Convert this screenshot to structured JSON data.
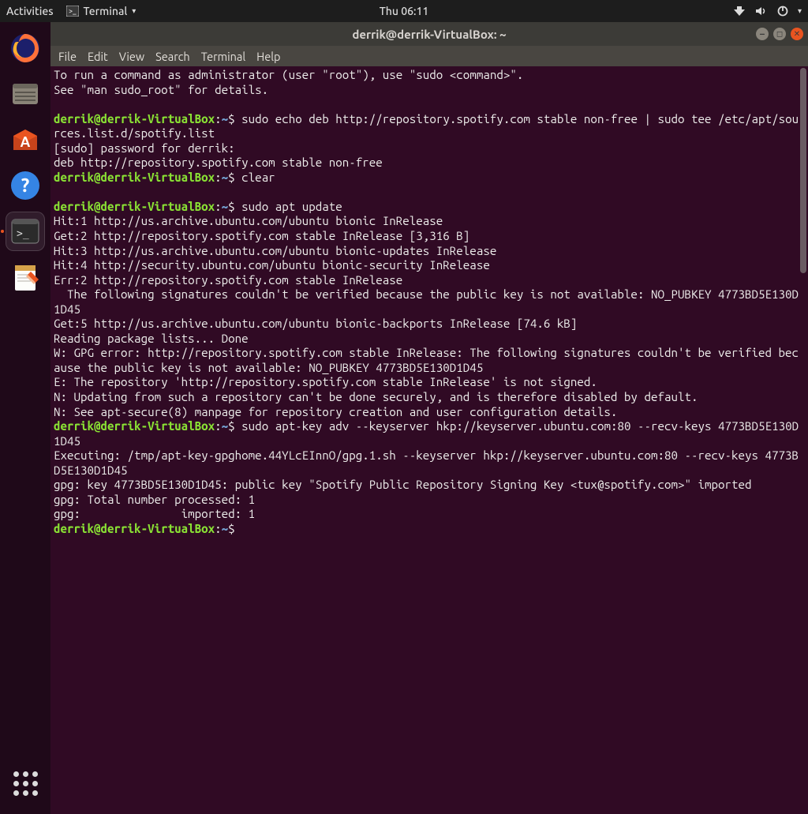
{
  "topbar": {
    "activities": "Activities",
    "app_label": "Terminal",
    "clock": "Thu 06:11"
  },
  "dock_icons": {
    "firefox": "firefox",
    "files": "files",
    "software": "software",
    "help": "help",
    "terminal": "terminal",
    "text_editor": "text-editor"
  },
  "window": {
    "title": "derrik@derrik-VirtualBox: ~"
  },
  "menu": {
    "file": "File",
    "edit": "Edit",
    "view": "View",
    "search": "Search",
    "terminal": "Terminal",
    "help": "Help"
  },
  "prompt": {
    "userhost": "derrik@derrik-VirtualBox",
    "colon": ":",
    "path": "~",
    "dollar": "$"
  },
  "lines": {
    "l0": "To run a command as administrator (user \"root\"), use \"sudo <command>\".",
    "l1": "See \"man sudo_root\" for details.",
    "l2": "",
    "cmd1": " sudo echo deb http://repository.spotify.com stable non-free | sudo tee /etc/apt/sources.list.d/spotify.list",
    "l3": "[sudo] password for derrik:",
    "l4": "deb http://repository.spotify.com stable non-free",
    "cmd2": " clear",
    "l5": "",
    "cmd3": " sudo apt update",
    "l6": "Hit:1 http://us.archive.ubuntu.com/ubuntu bionic InRelease",
    "l7": "Get:2 http://repository.spotify.com stable InRelease [3,316 B]",
    "l8": "Hit:3 http://us.archive.ubuntu.com/ubuntu bionic-updates InRelease",
    "l9": "Hit:4 http://security.ubuntu.com/ubuntu bionic-security InRelease",
    "l10": "Err:2 http://repository.spotify.com stable InRelease",
    "l11": "  The following signatures couldn't be verified because the public key is not available: NO_PUBKEY 4773BD5E130D1D45",
    "l12": "Get:5 http://us.archive.ubuntu.com/ubuntu bionic-backports InRelease [74.6 kB]",
    "l13": "Reading package lists... Done",
    "l14": "W: GPG error: http://repository.spotify.com stable InRelease: The following signatures couldn't be verified because the public key is not available: NO_PUBKEY 4773BD5E130D1D45",
    "l15": "E: The repository 'http://repository.spotify.com stable InRelease' is not signed.",
    "l16": "N: Updating from such a repository can't be done securely, and is therefore disabled by default.",
    "l17": "N: See apt-secure(8) manpage for repository creation and user configuration details.",
    "cmd4": " sudo apt-key adv --keyserver hkp://keyserver.ubuntu.com:80 --recv-keys 4773BD5E130D1D45",
    "l18": "Executing: /tmp/apt-key-gpghome.44YLcEInnO/gpg.1.sh --keyserver hkp://keyserver.ubuntu.com:80 --recv-keys 4773BD5E130D1D45",
    "l19": "gpg: key 4773BD5E130D1D45: public key \"Spotify Public Repository Signing Key <tux@spotify.com>\" imported",
    "l20": "gpg: Total number processed: 1",
    "l21": "gpg:               imported: 1",
    "cmd5": " "
  }
}
